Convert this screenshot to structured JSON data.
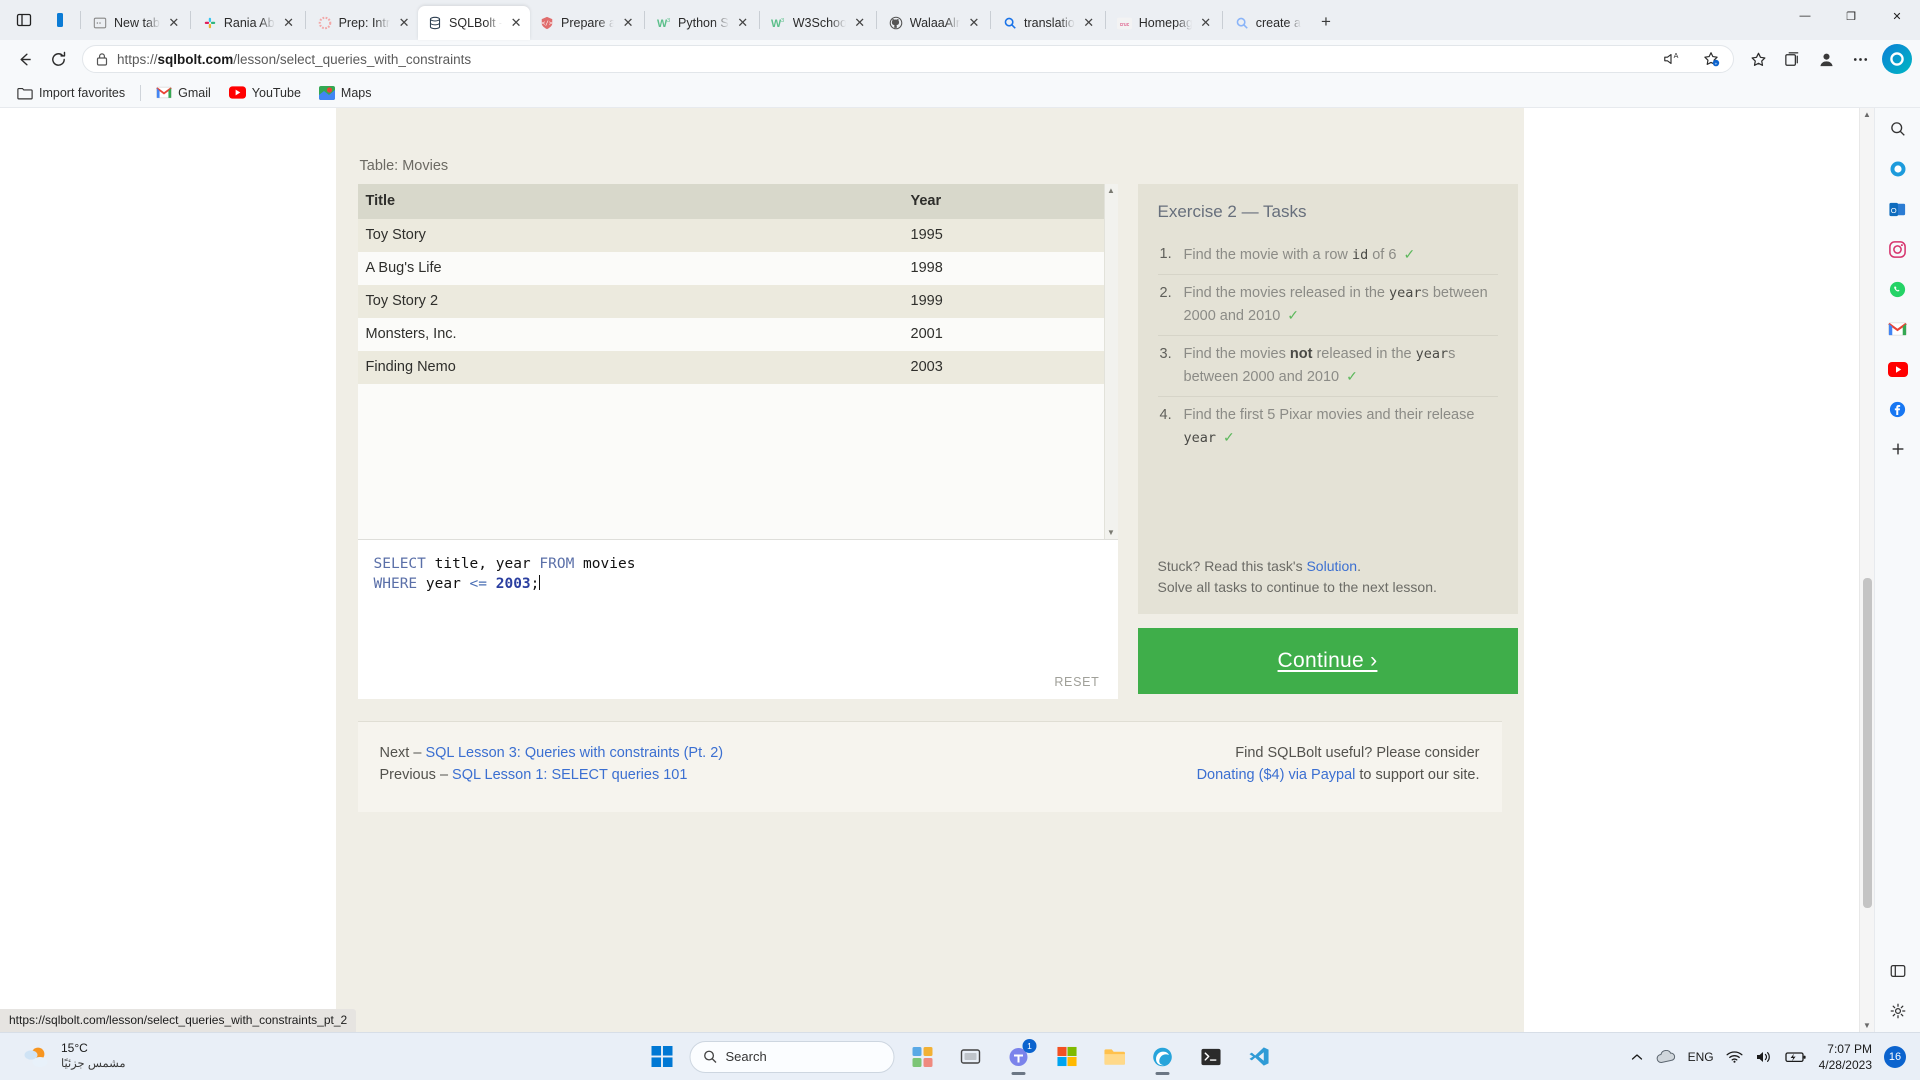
{
  "browser": {
    "tabs": [
      {
        "title": "New tab",
        "icon": "window-icon",
        "active": false
      },
      {
        "title": "Rania Ab",
        "icon": "slack-icon",
        "active": false
      },
      {
        "title": "Prep: Intr",
        "icon": "dots-circle-icon",
        "active": false
      },
      {
        "title": "SQLBolt -",
        "icon": "database-icon",
        "active": true
      },
      {
        "title": "Prepare a",
        "icon": "code-tag-icon",
        "active": false
      },
      {
        "title": "Python S",
        "icon": "w3schools-icon",
        "active": false
      },
      {
        "title": "W3Schoo",
        "icon": "w3schools-icon",
        "active": false
      },
      {
        "title": "WalaaAlr",
        "icon": "github-icon",
        "active": false
      },
      {
        "title": "translatio",
        "icon": "search-icon",
        "active": false
      },
      {
        "title": "Homepag",
        "icon": "cruc-icon",
        "active": false
      },
      {
        "title": "create a",
        "icon": "search-icon",
        "active": false
      }
    ],
    "new_tab_label": "+",
    "window_controls": {
      "minimize": "—",
      "maximize": "❐",
      "close": "✕"
    },
    "address": {
      "url_prefix": "https://",
      "url_domain": "sqlbolt.com",
      "url_path": "/lesson/select_queries_with_constraints",
      "full_url": "https://sqlbolt.com/lesson/select_queries_with_constraints"
    },
    "bookmarks": [
      {
        "label": "Import favorites",
        "icon": "folder-import-icon"
      },
      {
        "label": "Gmail",
        "icon": "gmail-icon"
      },
      {
        "label": "YouTube",
        "icon": "youtube-icon"
      },
      {
        "label": "Maps",
        "icon": "maps-icon"
      }
    ],
    "status_url": "https://sqlbolt.com/lesson/select_queries_with_constraints_pt_2"
  },
  "sidebar": {
    "items": [
      {
        "name": "search-icon",
        "glyph": "⌕"
      },
      {
        "name": "copilot-icon",
        "glyph": "◑"
      },
      {
        "name": "outlook-icon",
        "glyph": "O"
      },
      {
        "name": "instagram-icon",
        "glyph": "▢"
      },
      {
        "name": "whatsapp-icon",
        "glyph": "☎"
      },
      {
        "name": "gmail-icon",
        "glyph": "M"
      },
      {
        "name": "youtube-icon",
        "glyph": "▶"
      },
      {
        "name": "facebook-icon",
        "glyph": "f"
      },
      {
        "name": "add-tool-icon",
        "glyph": "+"
      },
      {
        "name": "browser-essentials-icon",
        "glyph": "□"
      },
      {
        "name": "settings-icon",
        "glyph": "⚙"
      }
    ]
  },
  "lesson": {
    "table_label": "Table: Movies",
    "table": {
      "columns": [
        "Title",
        "Year"
      ],
      "rows": [
        [
          "Toy Story",
          "1995"
        ],
        [
          "A Bug's Life",
          "1998"
        ],
        [
          "Toy Story 2",
          "1999"
        ],
        [
          "Monsters, Inc.",
          "2001"
        ],
        [
          "Finding Nemo",
          "2003"
        ]
      ]
    },
    "editor": {
      "line1": {
        "kw1": "SELECT",
        "text1": " title, year ",
        "kw2": "FROM",
        "text2": " movies"
      },
      "line2": {
        "kw1": "WHERE",
        "text1": " year ",
        "op": "<=",
        "num": " 2003",
        "semi": ";"
      },
      "reset_label": "RESET",
      "code_full": "SELECT title, year FROM movies\nWHERE year <= 2003;"
    },
    "exercise": {
      "title": "Exercise 2 — Tasks",
      "tasks": [
        {
          "parts": [
            {
              "t": "Find the movie with a row "
            },
            {
              "t": "id",
              "code": true
            },
            {
              "t": " of 6 "
            }
          ],
          "done": true
        },
        {
          "parts": [
            {
              "t": "Find the movies released in the "
            },
            {
              "t": "year",
              "code": true
            },
            {
              "t": "s between 2000 and 2010 "
            }
          ],
          "done": true
        },
        {
          "parts": [
            {
              "t": "Find the movies "
            },
            {
              "t": "not",
              "bold": true
            },
            {
              "t": " released in the "
            },
            {
              "t": "year",
              "code": true
            },
            {
              "t": "s between 2000 and 2010 "
            }
          ],
          "done": true
        },
        {
          "parts": [
            {
              "t": "Find the first 5 Pixar movies and their release "
            },
            {
              "t": "year",
              "code": true
            },
            {
              "t": " "
            }
          ],
          "done": true
        }
      ],
      "tick": "✓",
      "stuck_prefix": "Stuck? Read this task's ",
      "stuck_link": "Solution",
      "stuck_suffix": ".",
      "solve_note": "Solve all tasks to continue to the next lesson.",
      "continue_label": "Continue ›"
    },
    "footer": {
      "next_prefix": "Next – ",
      "next_link": "SQL Lesson 3: Queries with constraints (Pt. 2)",
      "prev_prefix": "Previous – ",
      "prev_link": "SQL Lesson 1: SELECT queries 101",
      "donate_prefix": "Find SQLBolt useful? Please consider",
      "donate_link": "Donating ($4) via Paypal",
      "donate_suffix": " to support our site."
    }
  },
  "taskbar": {
    "weather": {
      "temp": "15°C",
      "desc": "مشمس جزئيًا"
    },
    "search_placeholder": "Search",
    "apps": [
      {
        "name": "start-button",
        "glyph": "win"
      },
      {
        "name": "widgets-icon",
        "glyph": "▤"
      },
      {
        "name": "taskview-icon",
        "glyph": "▭"
      },
      {
        "name": "teams-icon",
        "glyph": "◯",
        "badge": "1"
      },
      {
        "name": "store-icon",
        "glyph": "▦"
      },
      {
        "name": "file-explorer-icon",
        "glyph": "▱"
      },
      {
        "name": "edge-icon",
        "glyph": "◔"
      },
      {
        "name": "terminal-icon",
        "glyph": "⌫"
      },
      {
        "name": "vscode-icon",
        "glyph": "⬡"
      }
    ],
    "tray": {
      "chevron": "⌃",
      "onedrive": "cloud",
      "language": "ENG",
      "wifi": "wifi",
      "volume": "volume",
      "battery": "battery",
      "time": "7:07 PM",
      "date": "4/28/2023",
      "notification_count": "16"
    }
  }
}
